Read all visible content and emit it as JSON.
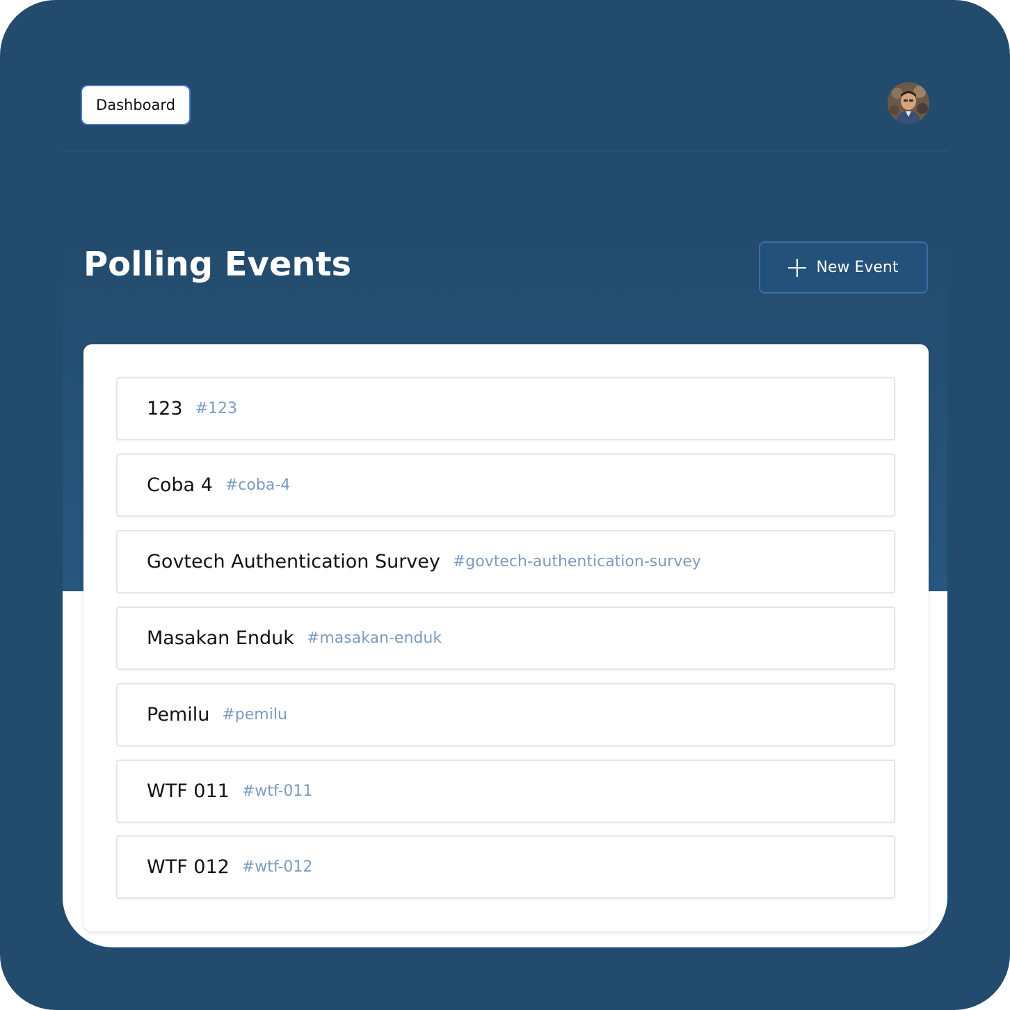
{
  "header": {
    "dashboard_label": "Dashboard",
    "avatar_icon": "user-avatar-photo"
  },
  "main": {
    "title": "Polling Events",
    "new_event_label": "New Event",
    "new_event_icon": "plus-icon"
  },
  "events": [
    {
      "name": "123",
      "slug": "#123"
    },
    {
      "name": "Coba 4",
      "slug": "#coba-4"
    },
    {
      "name": "Govtech Authentication Survey",
      "slug": "#govtech-authentication-survey"
    },
    {
      "name": "Masakan Enduk",
      "slug": "#masakan-enduk"
    },
    {
      "name": "Pemilu",
      "slug": "#pemilu"
    },
    {
      "name": "WTF 011",
      "slug": "#wtf-011"
    },
    {
      "name": "WTF 012",
      "slug": "#wtf-012"
    }
  ],
  "colors": {
    "background": "#234b6d",
    "slug_text": "#7b9bc0",
    "button_border": "#4b79c9"
  }
}
